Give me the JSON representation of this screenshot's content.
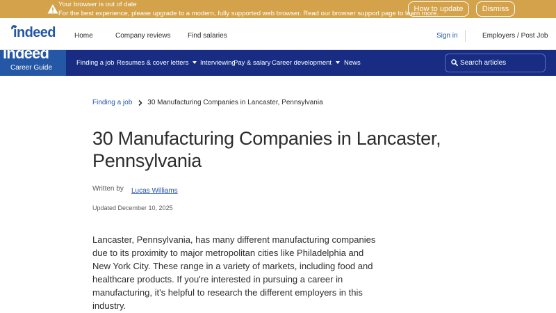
{
  "banner": {
    "title": "Your browser is out of date",
    "message": "For the best experience, please upgrade to a modern, fully supported web browser. Read our browser support page to learn more.",
    "update_label": "How to update",
    "dismiss_label": "Dismiss",
    "icon": "warning-icon",
    "color": "#d3a24a"
  },
  "topnav": {
    "logo": "indeed",
    "links": [
      "Home",
      "Company reviews",
      "Find salaries"
    ],
    "signin": "Sign in",
    "employers": "Employers / Post Job"
  },
  "guide": {
    "logo_big": "indeed",
    "logo_small": "Career Guide",
    "nav": [
      "Finding a job",
      "Resumes & cover letters",
      "Interviewing",
      "Pay & salary",
      "Career development",
      "News"
    ],
    "search_placeholder": "Search articles",
    "bar_color": "#172c82",
    "accent_color": "#2557a7"
  },
  "breadcrumb": {
    "parent": "Finding a job",
    "current": "30 Manufacturing Companies in Lancaster, Pennsylvania"
  },
  "article": {
    "title": "30 Manufacturing Companies in Lancaster, Pennsylvania",
    "written_by": "Written by",
    "author": "Lucas Williams",
    "updated": "Updated December 10, 2025",
    "intro": "Lancaster, Pennsylvania, has many different manufacturing companies due to its proximity to major metropolitan cities like Philadelphia and New York City. These range in a variety of markets, including food and healthcare products. If you're interested in pursuing a career in manufacturing, it's helpful to research the different employers in this industry."
  }
}
